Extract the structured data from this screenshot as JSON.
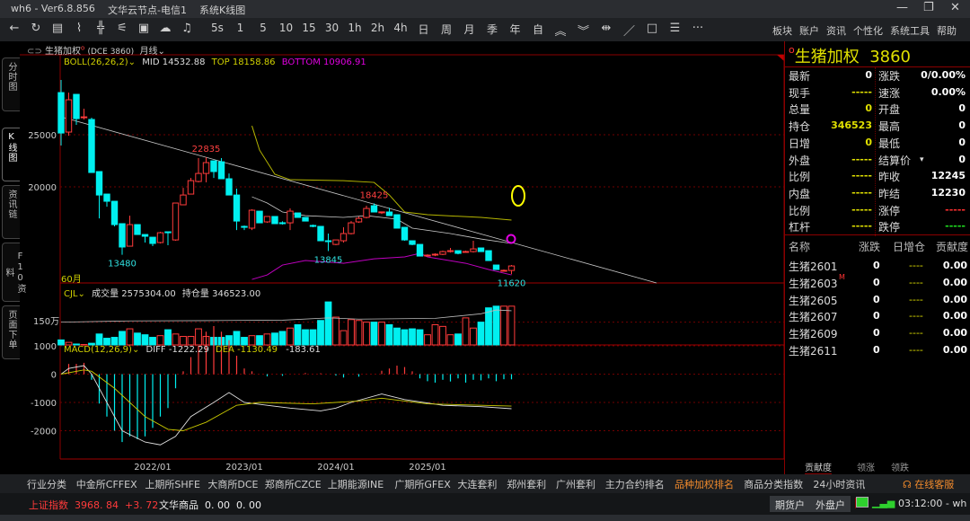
{
  "titlebar": {
    "app": "wh6  -  Ver6.8.856",
    "node": "文华云节点-电信1",
    "window": "系统K线图"
  },
  "toolbar": {
    "icons": [
      "back-arrow-icon",
      "refresh-icon",
      "table-icon",
      "line-chart-icon",
      "candlestick-icon",
      "split-icon",
      "panel-icon",
      "cloud-icon",
      "bell-icon"
    ],
    "periods": [
      "5s",
      "1",
      "5",
      "10",
      "15",
      "30",
      "1h",
      "2h",
      "4h",
      "日",
      "周",
      "月",
      "季",
      "年",
      "自"
    ],
    "tools": [
      "double-up-icon",
      "double-down-icon",
      "expand-icon",
      "draw-line-icon",
      "rectangle-icon",
      "list-icon",
      "more-icon"
    ],
    "menu": [
      "板块",
      "账户",
      "资讯",
      "个性化",
      "系统工具",
      "帮助"
    ]
  },
  "sidebar": {
    "tabs": [
      "分时图",
      "K线图",
      "资讯链",
      "F10资料",
      "页面下单"
    ],
    "active": 1
  },
  "chart_header": {
    "name": "生猪加权",
    "code": "(DCE  3860)",
    "period": "月线"
  },
  "boll": {
    "label": "BOLL(26,26,2)",
    "mid_label": "MID",
    "mid": "14532.88",
    "top_label": "TOP",
    "top": "18158.86",
    "bottom_label": "BOTTOM",
    "bottom": "10906.91"
  },
  "count_label": "60月",
  "cjl": {
    "label": "CJL",
    "vol_label": "成交量",
    "vol": "2575304.00",
    "oi_label": "持仓量",
    "oi": "346523.00",
    "axis_label": "150万"
  },
  "macd": {
    "label": "MACD(12,26,9)",
    "diff_label": "DIFF",
    "diff": "-1222.29",
    "dea_label": "DEA",
    "dea": "-1130.49",
    "macd": "-183.61"
  },
  "colors": {
    "up": "#ff3b3b",
    "down": "#00f0f0",
    "boll_top": "#b5b500",
    "boll_mid": "#c8c8c8",
    "boll_bottom": "#c000c0",
    "diff": "#e0e0e0",
    "dea": "#c8c800",
    "grid": "#8b0000"
  },
  "chart_data": {
    "type": "candlestick",
    "price_ylim": [
      10780,
      32590
    ],
    "price_ticks": [
      "25000",
      "20000"
    ],
    "x_ticks": [
      {
        "index": 13,
        "label": "2022/01"
      },
      {
        "index": 25,
        "label": "2023/01"
      },
      {
        "index": 37,
        "label": "2024/01"
      },
      {
        "index": 49,
        "label": "2025/01"
      }
    ],
    "ohlc": [
      [
        29050,
        30260,
        23970,
        25170
      ],
      [
        25260,
        29050,
        24910,
        28360
      ],
      [
        28880,
        28880,
        25950,
        26550
      ],
      [
        26640,
        27500,
        26470,
        26720
      ],
      [
        26470,
        26640,
        21380,
        21380
      ],
      [
        21470,
        21470,
        16980,
        19220
      ],
      [
        19310,
        19310,
        18100,
        18620
      ],
      [
        18620,
        18620,
        16210,
        16380
      ],
      [
        16470,
        16470,
        13480,
        14230
      ],
      [
        14310,
        17240,
        14310,
        16380
      ],
      [
        16380,
        16380,
        15430,
        15430
      ],
      [
        15430,
        15430,
        14660,
        15260
      ],
      [
        15170,
        15170,
        14310,
        14570
      ],
      [
        14660,
        15690,
        14570,
        15600
      ],
      [
        15690,
        15690,
        14400,
        15600
      ],
      [
        14910,
        18450,
        14830,
        18450
      ],
      [
        18280,
        19910,
        18280,
        19220
      ],
      [
        19310,
        20860,
        19310,
        20600
      ],
      [
        20520,
        22760,
        20430,
        21290
      ],
      [
        21290,
        22835,
        20430,
        22330
      ],
      [
        22500,
        22500,
        20860,
        21470
      ],
      [
        22410,
        22760,
        20780,
        20780
      ],
      [
        20780,
        21290,
        19220,
        19220
      ],
      [
        19220,
        19830,
        15860,
        16720
      ],
      [
        16210,
        16300,
        15860,
        16120
      ],
      [
        16040,
        17850,
        15860,
        17760
      ],
      [
        17670,
        17670,
        16550,
        16550
      ],
      [
        16640,
        17160,
        16550,
        17160
      ],
      [
        17160,
        17160,
        16470,
        16470
      ],
      [
        16560,
        16700,
        16380,
        16470
      ],
      [
        16550,
        17930,
        15860,
        17670
      ],
      [
        17500,
        17500,
        17070,
        17070
      ],
      [
        17070,
        17070,
        16720,
        16720
      ],
      [
        16300,
        16380,
        16120,
        16210
      ],
      [
        16210,
        16210,
        14830,
        14830
      ],
      [
        14830,
        15520,
        13845,
        14750
      ],
      [
        14480,
        14910,
        14400,
        14910
      ],
      [
        14830,
        16120,
        14660,
        15520
      ],
      [
        15520,
        16720,
        15430,
        16550
      ],
      [
        16640,
        17160,
        16550,
        16980
      ],
      [
        17070,
        18190,
        16980,
        17930
      ],
      [
        18190,
        18425,
        17590,
        17590
      ],
      [
        17590,
        17600,
        17400,
        17600
      ],
      [
        17590,
        18000,
        17240,
        17240
      ],
      [
        17330,
        17330,
        16040,
        16040
      ],
      [
        16120,
        16120,
        14830,
        14910
      ],
      [
        14830,
        14830,
        14400,
        14480
      ],
      [
        14480,
        14480,
        13360,
        13360
      ],
      [
        13450,
        13530,
        13360,
        13450
      ],
      [
        13530,
        13620,
        13360,
        13540
      ],
      [
        13530,
        13880,
        13450,
        13790
      ],
      [
        13790,
        14140,
        13700,
        13880
      ],
      [
        13880,
        13880,
        13530,
        13620
      ],
      [
        13790,
        13880,
        13700,
        13800
      ],
      [
        13790,
        14830,
        13700,
        14050
      ],
      [
        14140,
        14140,
        13790,
        13790
      ],
      [
        13880,
        13880,
        12930,
        12930
      ],
      [
        12500,
        12500,
        12070,
        12070
      ],
      [
        11980,
        12070,
        11900,
        11990
      ],
      [
        11980,
        12500,
        11620,
        12410
      ]
    ],
    "price_labels": [
      {
        "index": 9,
        "value": "13480",
        "price": 13480,
        "kind": "low"
      },
      {
        "index": 20,
        "value": "22835",
        "price": 22835,
        "kind": "high"
      },
      {
        "index": 36,
        "value": "13845",
        "price": 13845,
        "kind": "low"
      },
      {
        "index": 42,
        "value": "18425",
        "price": 18425,
        "kind": "high"
      },
      {
        "index": 60,
        "value": "11620",
        "price": 11620,
        "kind": "low"
      }
    ],
    "boll_top": [
      [
        26,
        25860
      ],
      [
        27,
        23530
      ],
      [
        29,
        21210
      ],
      [
        31,
        20690
      ],
      [
        38,
        20600
      ],
      [
        42,
        20430
      ],
      [
        44,
        19220
      ],
      [
        46,
        17590
      ],
      [
        49,
        17330
      ],
      [
        56,
        17070
      ],
      [
        60,
        16810
      ]
    ],
    "boll_mid": [
      [
        26,
        19050
      ],
      [
        28,
        18450
      ],
      [
        30,
        17590
      ],
      [
        33,
        17240
      ],
      [
        38,
        17070
      ],
      [
        41,
        17240
      ],
      [
        45,
        16900
      ],
      [
        47,
        16040
      ],
      [
        52,
        15520
      ],
      [
        56,
        15000
      ],
      [
        60,
        14570
      ]
    ],
    "boll_bottom": [
      [
        26,
        11120
      ],
      [
        28,
        11550
      ],
      [
        30,
        12500
      ],
      [
        33,
        12930
      ],
      [
        38,
        12670
      ],
      [
        42,
        13100
      ],
      [
        46,
        13280
      ],
      [
        48,
        13620
      ],
      [
        49,
        13280
      ],
      [
        54,
        12670
      ],
      [
        57,
        12070
      ],
      [
        60,
        11550
      ]
    ],
    "trendline": [
      [
        1,
        26720
      ],
      [
        79,
        10780
      ]
    ],
    "volume_wan": [
      33,
      17,
      6,
      3,
      11,
      72,
      44,
      50,
      89,
      106,
      78,
      67,
      50,
      61,
      100,
      72,
      56,
      56,
      106,
      56,
      50,
      50,
      61,
      89,
      50,
      61,
      61,
      72,
      78,
      89,
      111,
      133,
      100,
      100,
      161,
      283,
      183,
      94,
      167,
      161,
      150,
      150,
      150,
      133,
      111,
      100,
      106,
      100,
      67,
      133,
      122,
      67,
      72,
      178,
      111,
      150,
      244,
      255,
      255,
      255
    ],
    "volume_ylim": [
      0,
      390
    ],
    "open_interest_wan": [
      [
        1,
        150
      ],
      [
        10,
        158
      ],
      [
        20,
        160
      ],
      [
        30,
        163
      ],
      [
        36,
        178
      ],
      [
        40,
        170
      ],
      [
        50,
        175
      ],
      [
        56,
        205
      ],
      [
        58,
        230
      ],
      [
        60,
        225
      ]
    ],
    "macd_ylim": [
      -3000,
      1000
    ],
    "macd_ticks": [
      "1000",
      "0",
      "-1000",
      "-2000"
    ],
    "macd_hist": [
      0,
      360,
      360,
      400,
      -200,
      -1040,
      -1500,
      -2000,
      -2400,
      -2200,
      -2300,
      -2200,
      -1900,
      -1500,
      -1200,
      -500,
      100,
      600,
      1000,
      1500,
      1700,
      1500,
      1200,
      650,
      200,
      100,
      0,
      -80,
      0,
      -60,
      0,
      0,
      40,
      0,
      30,
      0,
      -50,
      -120,
      0,
      -90,
      0,
      0,
      120,
      200,
      300,
      250,
      100,
      -150,
      -250,
      -300,
      -200,
      -260,
      -150,
      -300,
      -200,
      -220,
      -150,
      -250,
      -180,
      -183.61
    ],
    "diff": [
      [
        1,
        0
      ],
      [
        2,
        200
      ],
      [
        4,
        300
      ],
      [
        5,
        0
      ],
      [
        9,
        -2000
      ],
      [
        12,
        -2400
      ],
      [
        14,
        -2500
      ],
      [
        16,
        -2200
      ],
      [
        18,
        -1500
      ],
      [
        21,
        -1000
      ],
      [
        23,
        -650
      ],
      [
        25,
        -1000
      ],
      [
        28,
        -1100
      ],
      [
        31,
        -1200
      ],
      [
        35,
        -1300
      ],
      [
        37,
        -1200
      ],
      [
        39,
        -1000
      ],
      [
        43,
        -700
      ],
      [
        46,
        -900
      ],
      [
        51,
        -1100
      ],
      [
        56,
        -1150
      ],
      [
        60,
        -1222.29
      ]
    ],
    "dea": [
      [
        1,
        0
      ],
      [
        4,
        150
      ],
      [
        5,
        100
      ],
      [
        8,
        -500
      ],
      [
        12,
        -1500
      ],
      [
        15,
        -1950
      ],
      [
        17,
        -2000
      ],
      [
        20,
        -1700
      ],
      [
        24,
        -1100
      ],
      [
        27,
        -1000
      ],
      [
        34,
        -1050
      ],
      [
        40,
        -950
      ],
      [
        43,
        -850
      ],
      [
        49,
        -1050
      ],
      [
        60,
        -1130.49
      ]
    ]
  },
  "quote": {
    "title": "生猪加权",
    "code": "3860",
    "left": [
      {
        "label": "最新",
        "value": "0",
        "color": "#ffffff"
      },
      {
        "label": "现手",
        "value": "-----",
        "color": "#e0e000"
      },
      {
        "label": "总量",
        "value": "0",
        "color": "#e0e000"
      },
      {
        "label": "持仓",
        "value": "346523",
        "color": "#e0e000"
      },
      {
        "label": "日增",
        "value": "0",
        "color": "#e0e000"
      },
      {
        "label": "外盘",
        "value": "-----",
        "color": "#e0e000"
      },
      {
        "label": "比例",
        "value": "-----",
        "color": "#e0e000"
      },
      {
        "label": "内盘",
        "value": "-----",
        "color": "#e0e000"
      },
      {
        "label": "比例",
        "value": "-----",
        "color": "#e0e000"
      },
      {
        "label": "杠杆",
        "value": "-----",
        "color": "#e0e000"
      }
    ],
    "right": [
      {
        "label": "涨跌",
        "value": "0/0.00%",
        "color": "#ffffff"
      },
      {
        "label": "速涨",
        "value": "0.00%",
        "color": "#ffffff"
      },
      {
        "label": "开盘",
        "value": "0",
        "color": "#ffffff"
      },
      {
        "label": "最高",
        "value": "0",
        "color": "#ffffff"
      },
      {
        "label": "最低",
        "value": "0",
        "color": "#ffffff"
      },
      {
        "label": "结算价",
        "value": "0",
        "color": "#ffffff",
        "dropdown": true
      },
      {
        "label": "昨收",
        "value": "12245",
        "color": "#ffffff"
      },
      {
        "label": "昨结",
        "value": "12230",
        "color": "#ffffff"
      },
      {
        "label": "涨停",
        "value": "-----",
        "color": "#ff3030"
      },
      {
        "label": "跌停",
        "value": "-----",
        "color": "#20e020"
      }
    ]
  },
  "contracts": {
    "headers": [
      "名称",
      "涨跌",
      "日增仓",
      "贡献度"
    ],
    "rows": [
      {
        "name": "生猪2601",
        "chg": "0",
        "oi": "----",
        "contrib": "0.00"
      },
      {
        "name": "生猪2603",
        "badge": "M",
        "chg": "0",
        "oi": "----",
        "contrib": "0.00"
      },
      {
        "name": "生猪2605",
        "chg": "0",
        "oi": "----",
        "contrib": "0.00"
      },
      {
        "name": "生猪2607",
        "chg": "0",
        "oi": "----",
        "contrib": "0.00"
      },
      {
        "name": "生猪2609",
        "chg": "0",
        "oi": "----",
        "contrib": "0.00"
      },
      {
        "name": "生猪2611",
        "chg": "0",
        "oi": "----",
        "contrib": "0.00"
      }
    ],
    "tabs": [
      "贡献度",
      "领涨",
      "领跌"
    ]
  },
  "nav": {
    "items": [
      "行业分类",
      "中金所CFFEX",
      "上期所SHFE",
      "大商所DCE",
      "郑商所CZCE",
      "上期能源INE",
      "广期所GFEX",
      "大连套利",
      "郑州套利",
      "广州套利",
      "主力合约排名",
      "品种加权排名",
      "商品分类指数",
      "24小时资讯"
    ],
    "active": 11,
    "support": "在线客服"
  },
  "status": {
    "index_name": "上证指数",
    "index_value": "3968. 84",
    "index_change": "+3. 72",
    "wh_name": "文华商品",
    "wh_value": "0. 00",
    "wh_change": "0. 00",
    "btn_futures": "期货户",
    "btn_foreign": "外盘户",
    "time": "03:12:00 - wh"
  }
}
